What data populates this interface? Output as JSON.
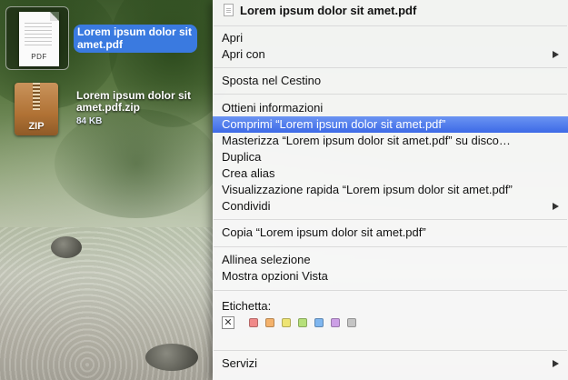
{
  "desktop": {
    "pdf_file": {
      "type_tag": "PDF",
      "name": "Lorem ipsum dolor sit\namet.pdf"
    },
    "zip_file": {
      "type_tag": "ZIP",
      "name": "Lorem ipsum dolor sit\namet.pdf.zip",
      "size": "84 KB"
    }
  },
  "context_menu": {
    "header": "Lorem ipsum dolor sit amet.pdf",
    "groups": {
      "open": [
        "Apri",
        "Apri con"
      ],
      "trash": [
        "Sposta nel Cestino"
      ],
      "actions": [
        "Ottieni informazioni",
        "Comprimi “Lorem ipsum dolor sit amet.pdf”",
        "Masterizza “Lorem ipsum dolor sit amet.pdf” su disco…",
        "Duplica",
        "Crea alias",
        "Visualizzazione rapida “Lorem ipsum dolor sit amet.pdf”",
        "Condividi"
      ],
      "copy": [
        "Copia “Lorem ipsum dolor sit amet.pdf”"
      ],
      "view": [
        "Allinea selezione",
        "Mostra opzioni Vista"
      ],
      "services": [
        "Servizi"
      ]
    },
    "highlighted_item": "Comprimi “Lorem ipsum dolor sit amet.pdf”",
    "label_section": {
      "title": "Etichetta:",
      "none_glyph": "✕",
      "colors": [
        {
          "name": "red",
          "color": "#f08a8a"
        },
        {
          "name": "orange",
          "color": "#f4b26c"
        },
        {
          "name": "yellow",
          "color": "#eee474"
        },
        {
          "name": "green",
          "color": "#b6e07a"
        },
        {
          "name": "blue",
          "color": "#7fb6ef"
        },
        {
          "name": "purple",
          "color": "#cc9fe6"
        },
        {
          "name": "gray",
          "color": "#c4c4c4"
        }
      ]
    }
  },
  "colors": {
    "highlight": "#3d6ae6",
    "selection_label": "#3a7ae0"
  }
}
